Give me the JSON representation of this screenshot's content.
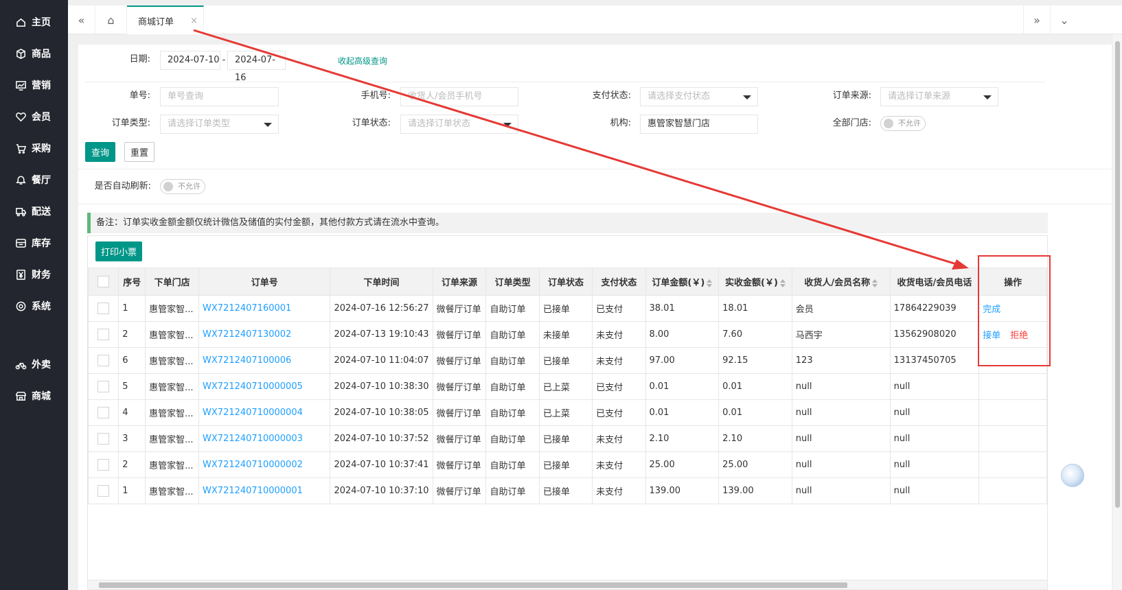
{
  "sidebar": {
    "items": [
      {
        "label": "主页",
        "icon": "home-icon"
      },
      {
        "label": "商品",
        "icon": "box-icon"
      },
      {
        "label": "营销",
        "icon": "chart-icon"
      },
      {
        "label": "会员",
        "icon": "heart-icon"
      },
      {
        "label": "采购",
        "icon": "cart-icon"
      },
      {
        "label": "餐厅",
        "icon": "bell-icon"
      },
      {
        "label": "配送",
        "icon": "truck-icon"
      },
      {
        "label": "库存",
        "icon": "warehouse-icon"
      },
      {
        "label": "财务",
        "icon": "yen-icon"
      },
      {
        "label": "系统",
        "icon": "settings-icon"
      },
      {
        "label": "外卖",
        "icon": "bike-icon"
      },
      {
        "label": "商城",
        "icon": "shop-icon"
      }
    ]
  },
  "tabbar": {
    "prev_icon": "«",
    "home_icon": "⌂",
    "tab_label": "商城订单",
    "tab_close": "×",
    "next_icon": "»",
    "more_icon": "⌄"
  },
  "filters": {
    "date_label": "日期:",
    "date_start": "2024-07-10",
    "date_sep": "-",
    "date_end": "2024-07-16",
    "toggle_advanced": "收起高级查询",
    "order_no_label": "单号:",
    "order_no_placeholder": "单号查询",
    "phone_label": "手机号:",
    "phone_placeholder": "收货人/会员手机号",
    "pay_status_label": "支付状态:",
    "pay_status_placeholder": "请选择支付状态",
    "source_label": "订单来源:",
    "source_placeholder": "请选择订单来源",
    "type_label": "订单类型:",
    "type_placeholder": "请选择订单类型",
    "state_label": "订单状态:",
    "state_placeholder": "请选择订单状态",
    "org_label": "机构:",
    "org_value": "惠管家智慧门店",
    "all_store_label": "全部门店:",
    "all_store_toggle": "不允许",
    "query_btn": "查询",
    "reset_btn": "重置",
    "auto_refresh_label": "是否自动刷新:",
    "auto_refresh_toggle": "不允许"
  },
  "note": "备注：订单实收金额金额仅统计微信及储值的实付金额，其他付款方式请在流水中查询。",
  "print_btn": "打印小票",
  "table": {
    "headers": [
      "序号",
      "下单门店",
      "订单号",
      "下单时间",
      "订单来源",
      "订单类型",
      "订单状态",
      "支付状态",
      "订单金额(￥)",
      "实收金额(￥)",
      "收货人/会员名称",
      "收货电话/会员电话",
      "操作"
    ],
    "rows": [
      {
        "seq": "1",
        "store": "惠管家智...",
        "no": "WX7212407160001",
        "time": "2024-07-16 12:56:27",
        "source": "微餐厅订单",
        "type": "自助订单",
        "state": "已接单",
        "pay": "已支付",
        "amount": "38.01",
        "paid": "18.01",
        "name": "会员",
        "phone": "17864229039",
        "ops": [
          {
            "label": "完成",
            "color": "blue"
          }
        ]
      },
      {
        "seq": "2",
        "store": "惠管家智...",
        "no": "WX7212407130002",
        "time": "2024-07-13 19:10:43",
        "source": "微餐厅订单",
        "type": "自助订单",
        "state": "未接单",
        "pay": "未支付",
        "amount": "8.00",
        "paid": "7.60",
        "name": "马西宇",
        "phone": "13562908020",
        "ops": [
          {
            "label": "接单",
            "color": "blue"
          },
          {
            "label": "拒绝",
            "color": "red"
          }
        ]
      },
      {
        "seq": "6",
        "store": "惠管家智...",
        "no": "WX7212407100006",
        "time": "2024-07-10 11:04:07",
        "source": "微餐厅订单",
        "type": "自助订单",
        "state": "已接单",
        "pay": "未支付",
        "amount": "97.00",
        "paid": "92.15",
        "name": "123",
        "phone": "13137450705",
        "ops": []
      },
      {
        "seq": "5",
        "store": "惠管家智...",
        "no": "WX721240710000005",
        "time": "2024-07-10 10:38:30",
        "source": "微餐厅订单",
        "type": "自助订单",
        "state": "已上菜",
        "pay": "已支付",
        "amount": "0.01",
        "paid": "0.01",
        "name": "null",
        "phone": "null",
        "ops": []
      },
      {
        "seq": "4",
        "store": "惠管家智...",
        "no": "WX721240710000004",
        "time": "2024-07-10 10:38:05",
        "source": "微餐厅订单",
        "type": "自助订单",
        "state": "已上菜",
        "pay": "已支付",
        "amount": "0.01",
        "paid": "0.01",
        "name": "null",
        "phone": "null",
        "ops": []
      },
      {
        "seq": "3",
        "store": "惠管家智...",
        "no": "WX721240710000003",
        "time": "2024-07-10 10:37:52",
        "source": "微餐厅订单",
        "type": "自助订单",
        "state": "已接单",
        "pay": "未支付",
        "amount": "2.10",
        "paid": "2.10",
        "name": "null",
        "phone": "null",
        "ops": []
      },
      {
        "seq": "2",
        "store": "惠管家智...",
        "no": "WX721240710000002",
        "time": "2024-07-10 10:37:41",
        "source": "微餐厅订单",
        "type": "自助订单",
        "state": "已接单",
        "pay": "未支付",
        "amount": "25.00",
        "paid": "25.00",
        "name": "null",
        "phone": "null",
        "ops": []
      },
      {
        "seq": "1",
        "store": "惠管家智...",
        "no": "WX721240710000001",
        "time": "2024-07-10 10:37:10",
        "source": "微餐厅订单",
        "type": "自助订单",
        "state": "已接单",
        "pay": "未支付",
        "amount": "139.00",
        "paid": "139.00",
        "name": "null",
        "phone": "null",
        "ops": []
      }
    ]
  },
  "colors": {
    "sidebar_bg": "#23262e",
    "accent": "#009688",
    "link": "#1e9fff",
    "danger": "#ff3b3b",
    "annotation": "#e53935"
  }
}
